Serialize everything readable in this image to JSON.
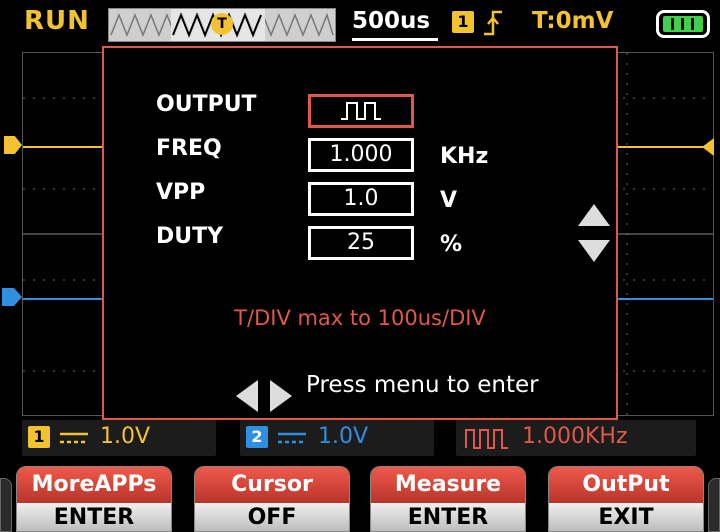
{
  "status_bar": {
    "run_state": "RUN",
    "timebase": "500us",
    "trigger_channel": "1",
    "trigger_edge_icon": "rising-edge-icon",
    "trigger_level": "T:0mV",
    "battery_icon": "battery-full-icon"
  },
  "output_dialog": {
    "rows": [
      {
        "label": "OUTPUT",
        "value": "",
        "value_icon": "square-wave-icon",
        "unit": ""
      },
      {
        "label": "FREQ",
        "value": "1.000",
        "unit": "KHz"
      },
      {
        "label": "VPP",
        "value": "1.0",
        "unit": "V"
      },
      {
        "label": "DUTY",
        "value": "25",
        "unit": "%"
      }
    ],
    "warning": "T/DIV max to 100us/DIV",
    "hint": "Press menu to enter"
  },
  "channel_status": {
    "ch1": {
      "badge": "1",
      "value": "1.0V",
      "color": "#f2c230"
    },
    "ch2": {
      "badge": "2",
      "value": "1.0V",
      "color": "#2f8fe0"
    },
    "generator": {
      "value": "1.000KHz",
      "color": "#e0584a"
    }
  },
  "softkeys": [
    {
      "top": "MoreAPPs",
      "bottom": "ENTER"
    },
    {
      "top": "Cursor",
      "bottom": "OFF"
    },
    {
      "top": "Measure",
      "bottom": "ENTER"
    },
    {
      "top": "OutPut",
      "bottom": "EXIT"
    }
  ],
  "colors": {
    "ch1": "#f2c230",
    "ch2": "#2f8fe0",
    "accent": "#e0584a",
    "background": "#000000"
  }
}
